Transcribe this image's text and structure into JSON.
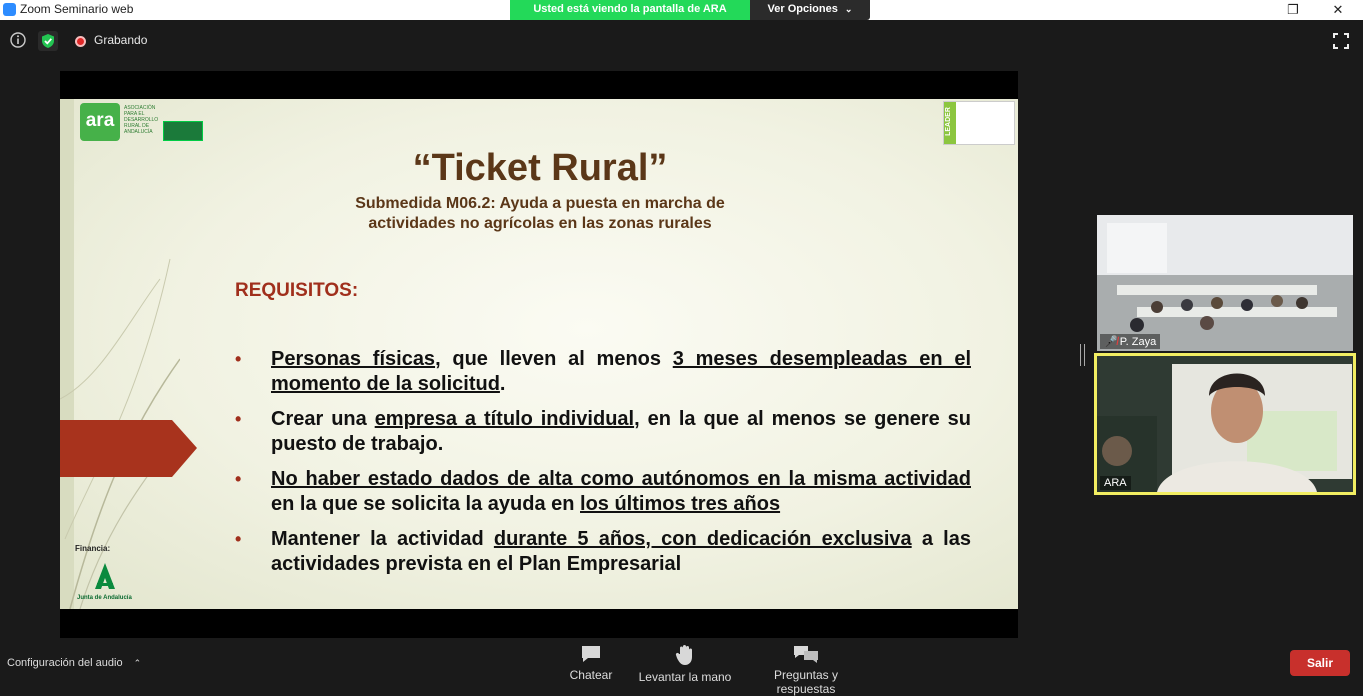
{
  "window": {
    "title": "Zoom Seminario web"
  },
  "share_banner": {
    "viewing": "Usted está viendo la pantalla de ARA",
    "options": "Ver Opciones"
  },
  "toolbar": {
    "recording": "Grabando"
  },
  "slide": {
    "title": "“Ticket Rural”",
    "subtitle_line1": "Submedida M06.2: Ayuda a puesta en marcha de",
    "subtitle_line2": "actividades no agrícolas en las zonas rurales",
    "section": "REQUISITOS:",
    "b1": {
      "u1": "Personas físicas",
      "t1": ", que lleven al menos ",
      "u2": "3 meses desempleadas en el momento de la solicitud",
      "t2": "."
    },
    "b2": {
      "t1": "Crear una ",
      "u1": "empresa a título individual",
      "t2": ", en la que al menos se genere su puesto de trabajo."
    },
    "b3": {
      "u1": "No haber estado dados de alta como autónomos en la misma actividad ",
      "t1": "en la que se solicita la ayuda en ",
      "u2": "los últimos tres años"
    },
    "b4": {
      "t1": "Mantener la actividad ",
      "u1": "durante 5 años, con dedicación exclusiva",
      "t2": " a las actividades prevista en el Plan Empresarial"
    },
    "logo_ara": "ara",
    "logo_ara_text": "ASOCIACIÓN PARA EL DESARROLLO RURAL DE ANDALUCÍA",
    "leader_label": "LEADER",
    "financia": "Financia:",
    "junta": "Junta de Andalucía"
  },
  "participants": [
    {
      "name": "P. Zaya",
      "muted": true
    },
    {
      "name": "ARA",
      "muted": false,
      "active_speaker": true
    }
  ],
  "bottombar": {
    "audio": "Configuración del audio",
    "chat": "Chatear",
    "raise_hand": "Levantar la mano",
    "qa": "Preguntas y respuestas",
    "exit": "Salir"
  },
  "colors": {
    "banner_green": "#23d959",
    "exit_red": "#c8302c",
    "speaker_border": "#f2ee62"
  }
}
